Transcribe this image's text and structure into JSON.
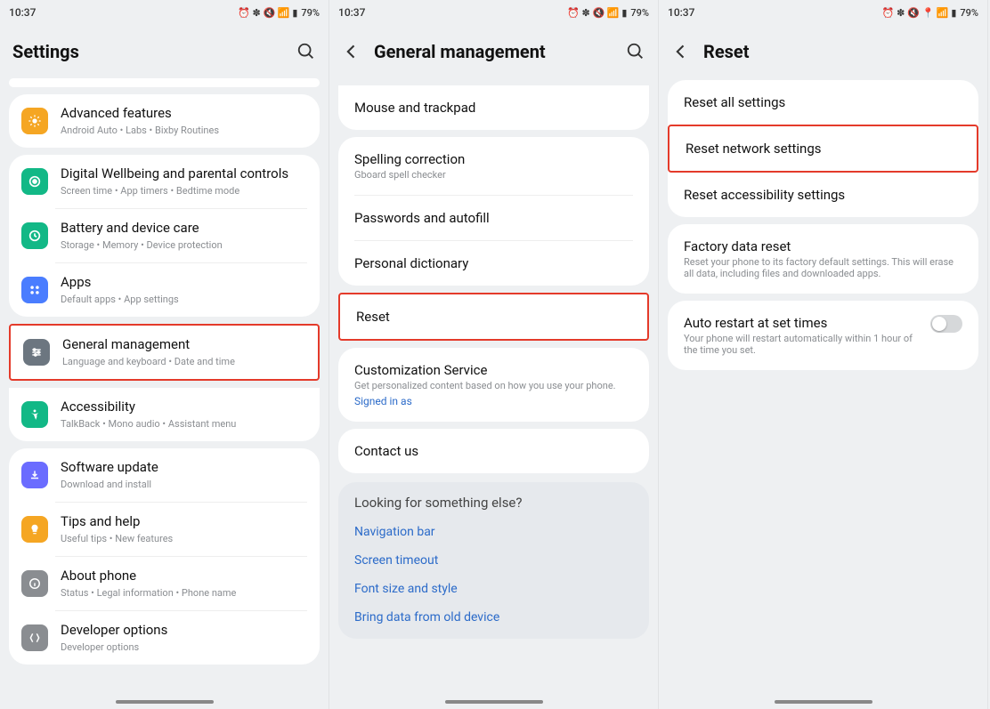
{
  "status": {
    "time": "10:37",
    "battery": "79%",
    "icons": "⏰ ✽ 🔇 📶 ▮"
  },
  "status3": {
    "icons": "⏰ ✽ 🔇 📍 📶 ▮"
  },
  "screen1": {
    "title": "Settings",
    "items": [
      {
        "icon": "advanced",
        "color": "#f5a623",
        "title": "Advanced features",
        "sub": "Android Auto  •  Labs  •  Bixby Routines"
      },
      {
        "icon": "wellbeing",
        "color": "#12b886",
        "title": "Digital Wellbeing and parental controls",
        "sub": "Screen time  •  App timers  •  Bedtime mode"
      },
      {
        "icon": "battery",
        "color": "#12b886",
        "title": "Battery and device care",
        "sub": "Storage  •  Memory  •  Device protection"
      },
      {
        "icon": "apps",
        "color": "#4a7dff",
        "title": "Apps",
        "sub": "Default apps  •  App settings"
      },
      {
        "icon": "general",
        "color": "#6c7680",
        "title": "General management",
        "sub": "Language and keyboard  •  Date and time",
        "highlight": true
      },
      {
        "icon": "accessibility",
        "color": "#12b886",
        "title": "Accessibility",
        "sub": "TalkBack  •  Mono audio  •  Assistant menu"
      },
      {
        "icon": "software",
        "color": "#6b6cff",
        "title": "Software update",
        "sub": "Download and install"
      },
      {
        "icon": "tips",
        "color": "#f5a623",
        "title": "Tips and help",
        "sub": "Useful tips  •  New features"
      },
      {
        "icon": "about",
        "color": "#8a8d91",
        "title": "About phone",
        "sub": "Status  •  Legal information  •  Phone name"
      },
      {
        "icon": "developer",
        "color": "#8a8d91",
        "title": "Developer options",
        "sub": "Developer options"
      }
    ]
  },
  "screen2": {
    "title": "General management",
    "group1": [
      {
        "title": "Mouse and trackpad"
      }
    ],
    "group2": [
      {
        "title": "Spelling correction",
        "sub": "Gboard spell checker"
      },
      {
        "title": "Passwords and autofill"
      },
      {
        "title": "Personal dictionary"
      }
    ],
    "group3": [
      {
        "title": "Reset",
        "highlight": true
      }
    ],
    "group4": [
      {
        "title": "Customization Service",
        "sub": "Get personalized content based on how you use your phone.",
        "signed": "Signed in as"
      }
    ],
    "group5": [
      {
        "title": "Contact us"
      }
    ],
    "looking": {
      "title": "Looking for something else?",
      "links": [
        "Navigation bar",
        "Screen timeout",
        "Font size and style",
        "Bring data from old device"
      ]
    }
  },
  "screen3": {
    "title": "Reset",
    "group1": [
      {
        "title": "Reset all settings"
      },
      {
        "title": "Reset network settings",
        "highlight": true
      },
      {
        "title": "Reset accessibility settings"
      }
    ],
    "group2": [
      {
        "title": "Factory data reset",
        "sub": "Reset your phone to its factory default settings. This will erase all data, including files and downloaded apps."
      }
    ],
    "group3": [
      {
        "title": "Auto restart at set times",
        "sub": "Your phone will restart automatically within 1 hour of the time you set.",
        "toggle": true
      }
    ]
  }
}
